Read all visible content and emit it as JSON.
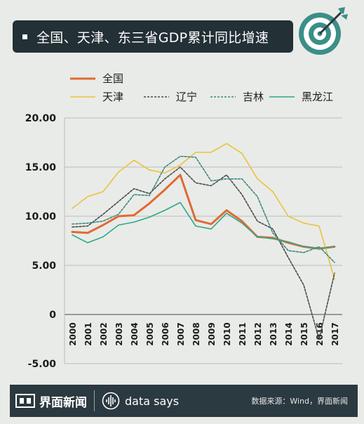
{
  "header": {
    "title": "全国、天津、东三省GDP累计同比增速",
    "icon": "target-icon"
  },
  "footer": {
    "brand": "界面新闻",
    "tagline": "data says",
    "source": "数据来源：Wind，界面新闻"
  },
  "colors": {
    "background": "#e9ebe8",
    "header_bg": "#233036",
    "footer_bg": "#2b3940"
  },
  "chart_data": {
    "type": "line",
    "x": [
      "2000",
      "2001",
      "2002",
      "2003",
      "2004",
      "2005",
      "2006",
      "2007",
      "2008",
      "2009",
      "2010",
      "2011",
      "2012",
      "2013",
      "2014",
      "2015",
      "2016",
      "2017"
    ],
    "ylim": [
      -5,
      20
    ],
    "yticks": [
      "20.00",
      "15.00",
      "10.00",
      "5.00",
      "0",
      "-5.00"
    ],
    "ytick_values": [
      20,
      15,
      10,
      5,
      0,
      -5
    ],
    "legend_position": "top",
    "grid": "horizontal",
    "series": [
      {
        "name": "全国",
        "color": "#e06a33",
        "style": "solid",
        "width": 3,
        "values": [
          8.4,
          8.3,
          9.1,
          10.0,
          10.1,
          11.3,
          12.7,
          14.2,
          9.6,
          9.2,
          10.6,
          9.5,
          7.9,
          7.8,
          7.3,
          6.9,
          6.7,
          6.9
        ]
      },
      {
        "name": "天津",
        "color": "#ecc13f",
        "style": "solid",
        "width": 1.6,
        "values": [
          10.8,
          12.0,
          12.5,
          14.5,
          15.7,
          14.7,
          14.4,
          15.2,
          16.5,
          16.5,
          17.4,
          16.4,
          13.8,
          12.5,
          10.0,
          9.3,
          9.0,
          3.6
        ]
      },
      {
        "name": "辽宁",
        "color": "#4a4a4a",
        "style": "dashed",
        "width": 1.6,
        "values": [
          8.9,
          9.0,
          10.2,
          11.5,
          12.8,
          12.3,
          13.8,
          15.0,
          13.4,
          13.1,
          14.2,
          12.2,
          9.5,
          8.7,
          5.8,
          3.0,
          -2.5,
          4.2
        ]
      },
      {
        "name": "吉林",
        "color": "#3d8a7e",
        "style": "dashed",
        "width": 1.6,
        "values": [
          9.2,
          9.3,
          9.5,
          10.2,
          12.2,
          12.1,
          15.0,
          16.1,
          16.0,
          13.6,
          13.8,
          13.8,
          12.0,
          8.3,
          6.5,
          6.3,
          6.9,
          5.3
        ]
      },
      {
        "name": "黑龙江",
        "color": "#2fa889",
        "style": "solid",
        "width": 1.6,
        "values": [
          8.1,
          7.3,
          7.9,
          9.1,
          9.4,
          9.9,
          10.6,
          11.4,
          9.0,
          8.7,
          10.3,
          9.3,
          7.9,
          7.7,
          7.4,
          6.9,
          6.7,
          6.9
        ]
      }
    ]
  }
}
